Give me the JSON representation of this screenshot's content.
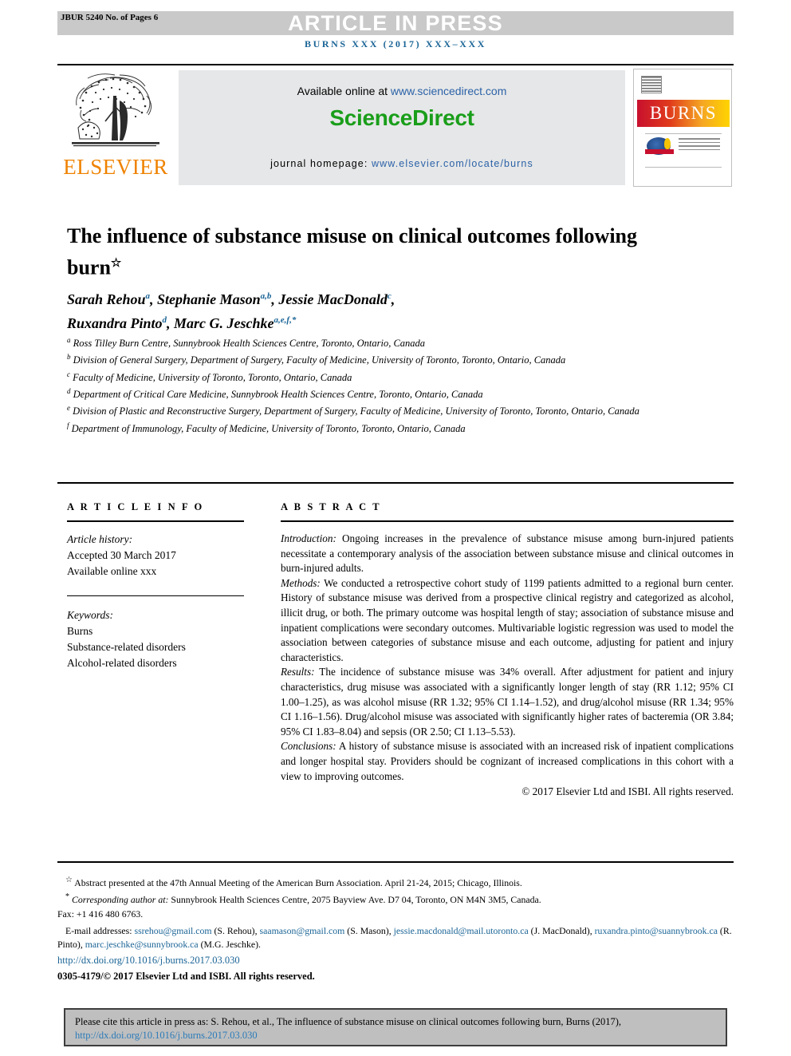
{
  "header": {
    "jbur_code": "JBUR 5240 No. of Pages 6",
    "press_banner": "ARTICLE IN PRESS",
    "journal_ref": "BURNS XXX (2017) XXX–XXX",
    "banner_bg": "#c9c9c9",
    "journal_ref_color": "#1a6496"
  },
  "masthead": {
    "publisher": "ELSEVIER",
    "publisher_color": "#ef8200",
    "available_prefix": "Available online at ",
    "available_url": "www.sciencedirect.com",
    "sciencedirect_logo": "ScienceDirect",
    "sciencedirect_color": "#1a9e1a",
    "homepage_prefix": "journal homepage: ",
    "homepage_url": "www.elsevier.com/locate/burns",
    "cover_title": "BURNS"
  },
  "article": {
    "title": "The influence of substance misuse on clinical outcomes following burn",
    "title_marker": "☆",
    "authors": [
      {
        "name": "Sarah Rehou",
        "sup": "a",
        "sep": ", "
      },
      {
        "name": "Stephanie Mason",
        "sup": "a,b",
        "sep": ", "
      },
      {
        "name": "Jessie MacDonald",
        "sup": "c",
        "sep": ", "
      },
      {
        "name": "Ruxandra Pinto",
        "sup": "d",
        "sep": ", "
      },
      {
        "name": "Marc G. Jeschke",
        "sup": "a,e,f,*",
        "sep": ""
      }
    ],
    "affiliations": [
      {
        "mark": "a",
        "text": "Ross Tilley Burn Centre, Sunnybrook Health Sciences Centre, Toronto, Ontario, Canada"
      },
      {
        "mark": "b",
        "text": "Division of General Surgery, Department of Surgery, Faculty of Medicine, University of Toronto, Toronto, Ontario, Canada"
      },
      {
        "mark": "c",
        "text": "Faculty of Medicine, University of Toronto, Toronto, Ontario, Canada"
      },
      {
        "mark": "d",
        "text": "Department of Critical Care Medicine, Sunnybrook Health Sciences Centre, Toronto, Ontario, Canada"
      },
      {
        "mark": "e",
        "text": "Division of Plastic and Reconstructive Surgery, Department of Surgery, Faculty of Medicine, University of Toronto, Toronto, Ontario, Canada"
      },
      {
        "mark": "f",
        "text": "Department of Immunology, Faculty of Medicine, University of Toronto, Toronto, Ontario, Canada"
      }
    ]
  },
  "article_info": {
    "heading": "A R T I C L E   I N F O",
    "history_label": "Article history:",
    "accepted": "Accepted 30 March 2017",
    "available_online": "Available online xxx",
    "keywords_label": "Keywords:",
    "keywords": [
      "Burns",
      "Substance-related disorders",
      "Alcohol-related disorders"
    ]
  },
  "abstract": {
    "heading": "A B S T R A C T",
    "sections": [
      {
        "label": "Introduction:",
        "body": " Ongoing increases in the prevalence of substance misuse among burn-injured patients necessitate a contemporary analysis of the association between substance misuse and clinical outcomes in burn-injured adults."
      },
      {
        "label": "Methods:",
        "body": " We conducted a retrospective cohort study of 1199 patients admitted to a regional burn center. History of substance misuse was derived from a prospective clinical registry and categorized as alcohol, illicit drug, or both. The primary outcome was hospital length of stay; association of substance misuse and inpatient complications were secondary outcomes. Multivariable logistic regression was used to model the association between categories of substance misuse and each outcome, adjusting for patient and injury characteristics."
      },
      {
        "label": "Results:",
        "body": " The incidence of substance misuse was 34% overall. After adjustment for patient and injury characteristics, drug misuse was associated with a significantly longer length of stay (RR 1.12; 95% CI 1.00–1.25), as was alcohol misuse (RR 1.32; 95% CI 1.14–1.52), and drug/alcohol misuse (RR 1.34; 95% CI 1.16–1.56). Drug/alcohol misuse was associated with significantly higher rates of bacteremia (OR 3.84; 95% CI 1.83–8.04) and sepsis (OR 2.50; CI 1.13–5.53)."
      },
      {
        "label": "Conclusions:",
        "body": " A history of substance misuse is associated with an increased risk of inpatient complications and longer hospital stay. Providers should be cognizant of increased complications in this cohort with a view to improving outcomes."
      }
    ],
    "copyright": "© 2017 Elsevier Ltd and ISBI. All rights reserved."
  },
  "footnotes": {
    "star_note": "Abstract presented at the 47th Annual Meeting of the American Burn Association. April 21-24, 2015; Chicago, Illinois.",
    "corresponding_label": "Corresponding author at:",
    "corresponding_text": " Sunnybrook Health Sciences Centre, 2075 Bayview Ave. D7 04, Toronto, ON M4N 3M5, Canada.",
    "fax": "Fax: +1 416 480 6763.",
    "email_label": "E-mail addresses:",
    "emails": [
      {
        "address": "ssrehou@gmail.com",
        "owner": " (S. Rehou), "
      },
      {
        "address": "saamason@gmail.com",
        "owner": " (S. Mason), "
      },
      {
        "address": "jessie.macdonald@mail.utoronto.ca",
        "owner": " (J. MacDonald), "
      },
      {
        "address": "ruxandra.pinto@suannybrook.ca",
        "owner": " (R. Pinto), "
      },
      {
        "address": "marc.jeschke@sunnybrook.ca",
        "owner": " (M.G. Jeschke)."
      }
    ],
    "doi": "http://dx.doi.org/10.1016/j.burns.2017.03.030",
    "issn_line": "0305-4179/© 2017 Elsevier Ltd and ISBI. All rights reserved.",
    "link_color": "#1a6496"
  },
  "citation_box": {
    "text": "Please cite this article in press as: S. Rehou, et al., The influence of substance misuse on clinical outcomes following burn, Burns (2017),",
    "doi": "http://dx.doi.org/10.1016/j.burns.2017.03.030",
    "bg": "#bfbfbf",
    "border": "#3d3d3d"
  }
}
